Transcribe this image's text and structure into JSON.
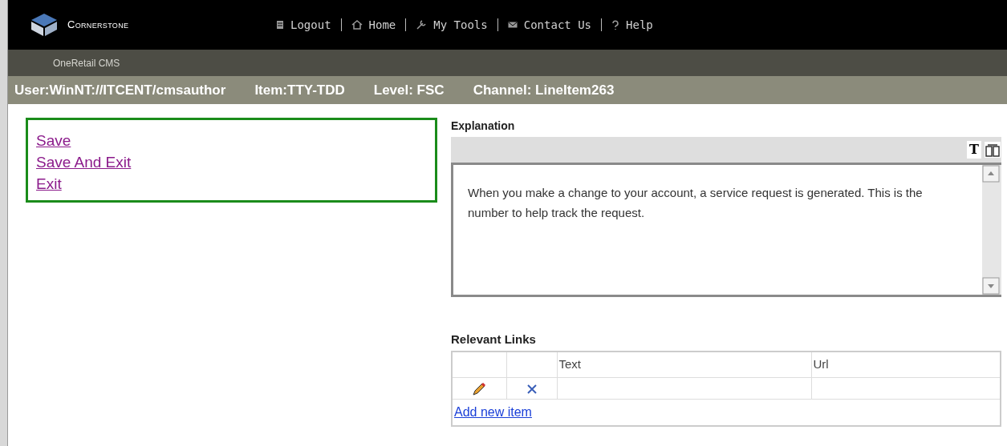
{
  "header": {
    "logo_text": "Cornerstone",
    "nav": [
      {
        "label": "Logout"
      },
      {
        "label": "Home"
      },
      {
        "label": "My Tools"
      },
      {
        "label": "Contact Us"
      },
      {
        "label": "Help"
      }
    ]
  },
  "subheader": {
    "title": "OneRetail CMS"
  },
  "info_bar": [
    "User:WinNT://ITCENT/cmsauthor",
    "Item:TTY-TDD",
    "Level: FSC",
    "Channel: LineItem263"
  ],
  "actions": [
    "Save",
    "Save And Exit",
    "Exit"
  ],
  "explanation": {
    "label": "Explanation",
    "toolbar": [
      "T"
    ],
    "text": "When you make a change to your account, a service request is generated.  This is the number to help track the request."
  },
  "links": {
    "label": "Relevant Links",
    "columns": [
      "Text",
      "Url"
    ],
    "add_link": "Add new item"
  }
}
